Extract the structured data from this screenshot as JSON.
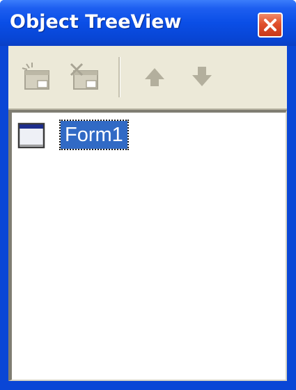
{
  "window": {
    "title": "Object TreeView"
  },
  "toolbar": {
    "buttons": [
      {
        "icon": "new-item-icon",
        "enabled": false
      },
      {
        "icon": "delete-item-icon",
        "enabled": false
      },
      {
        "icon": "arrow-up-icon",
        "enabled": false
      },
      {
        "icon": "arrow-down-icon",
        "enabled": false
      }
    ]
  },
  "tree": {
    "nodes": [
      {
        "label": "Form1",
        "icon": "form-window-icon",
        "selected": true
      }
    ]
  },
  "colors": {
    "title_bar": "#0a4ee6",
    "toolbar_bg": "#ece9d8",
    "selection": "#316ac5",
    "close_button": "#e0502c"
  }
}
